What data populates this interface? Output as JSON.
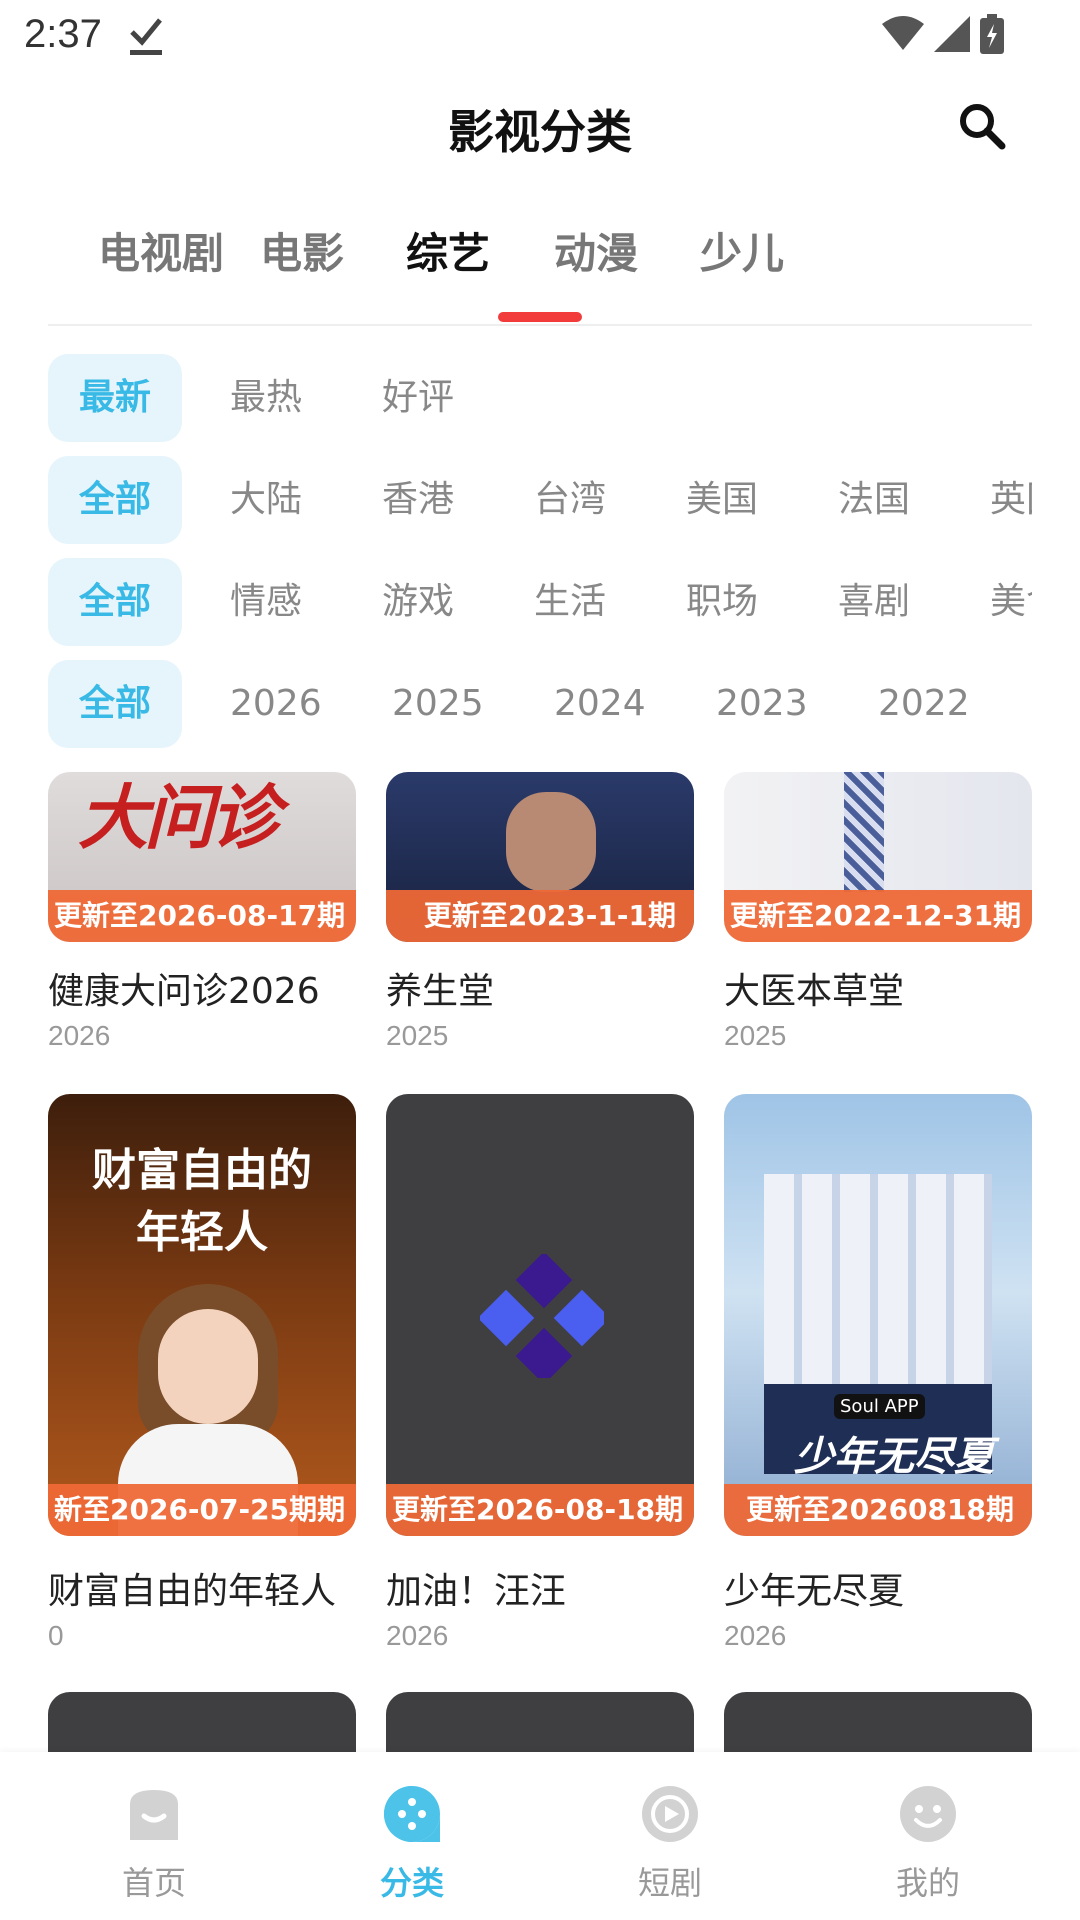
{
  "status": {
    "time": "2:37"
  },
  "header": {
    "title": "影视分类"
  },
  "tabs": [
    "电视剧",
    "电影",
    "综艺",
    "动漫",
    "少儿"
  ],
  "filters": {
    "sort": [
      "最新",
      "最热",
      "好评"
    ],
    "region": [
      "全部",
      "大陆",
      "香港",
      "台湾",
      "美国",
      "法国",
      "英国"
    ],
    "genre": [
      "全部",
      "情感",
      "游戏",
      "生活",
      "职场",
      "喜剧",
      "美食"
    ],
    "year": [
      "全部",
      "2026",
      "2025",
      "2024",
      "2023",
      "2022"
    ]
  },
  "cards": [
    {
      "title": "健康大问诊2026",
      "year": "2026",
      "badge": "更新至2026-08-17期",
      "poster_text": "大问诊"
    },
    {
      "title": "养生堂",
      "year": "2025",
      "badge": "更新至2023-1-1期"
    },
    {
      "title": "大医本草堂",
      "year": "2025",
      "badge": "更新至2022-12-31期"
    },
    {
      "title": "财富自由的年轻人",
      "year": "0",
      "badge": "新至2026-07-25期期",
      "poster_text": "财富自由的年轻人"
    },
    {
      "title": "加油！汪汪",
      "year": "2026",
      "badge": "更新至2026-08-18期"
    },
    {
      "title": "少年无尽夏",
      "year": "2026",
      "badge": "更新至20260818期",
      "poster_text": "少年无尽夏",
      "poster_logo": "Soul APP"
    }
  ],
  "nav": [
    {
      "label": "首页",
      "icon": "home-icon"
    },
    {
      "label": "分类",
      "icon": "category-icon",
      "active": true
    },
    {
      "label": "短剧",
      "icon": "play-icon"
    },
    {
      "label": "我的",
      "icon": "profile-icon"
    }
  ],
  "colors": {
    "accent": "#39b9e6",
    "tab_indicator": "#f23c3c",
    "badge": "#ee6836"
  }
}
